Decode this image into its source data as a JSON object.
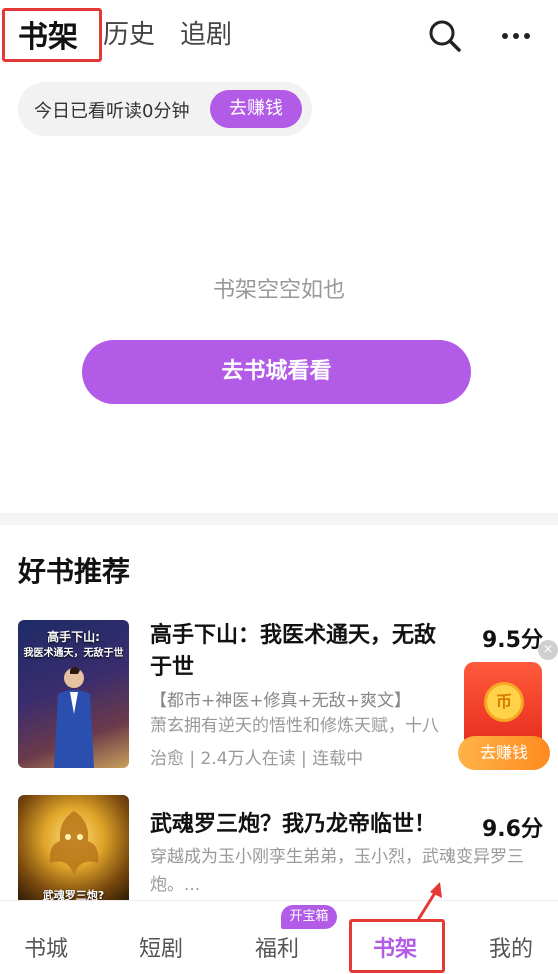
{
  "top_tabs": {
    "bookshelf": "书架",
    "history": "历史",
    "drama": "追剧"
  },
  "icons": {
    "search": "search-icon",
    "more": "more-icon"
  },
  "reading": {
    "today_text": "今日已看听读0分钟",
    "earn_label": "去赚钱"
  },
  "empty_state": {
    "message": "书架空空如也",
    "button_label": "去书城看看"
  },
  "recommend": {
    "title": "好书推荐",
    "books": [
      {
        "name": "高手下山：我医术通天，无敌于世",
        "score": "9.5分",
        "tags": "【都市+神医+修真+无敌+爽文】",
        "desc": "萧玄拥有逆天的悟性和修炼天赋，十八",
        "meta": "治愈 | 2.4万人在读 | 连载中",
        "cover_title_1": "高手下山:",
        "cover_title_2": "我医术通天，无敌于世"
      },
      {
        "name": "武魂罗三炮？我乃龙帝临世！",
        "score": "9.6分",
        "desc": "穿越成为玉小刚孪生弟弟，玉小烈，武魂变异罗三炮。...",
        "cover_title_1": "武魂罗三炮?"
      }
    ]
  },
  "float_widget": {
    "close": "×",
    "coin": "币",
    "label": "去赚钱"
  },
  "bottom_nav": {
    "store": "书城",
    "short_drama": "短剧",
    "welfare": "福利",
    "welfare_badge": "开宝箱",
    "bookshelf": "书架",
    "mine": "我的"
  },
  "colors": {
    "accent": "#b25be6",
    "highlight_box": "#e53935"
  }
}
